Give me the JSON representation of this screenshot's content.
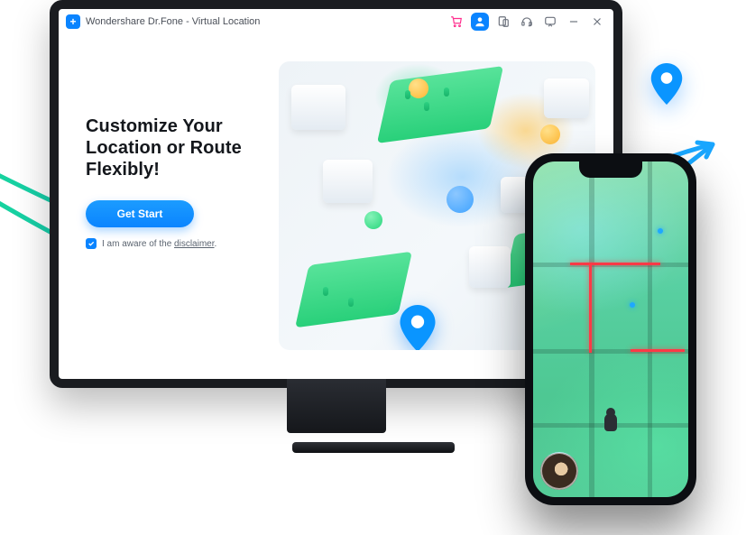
{
  "titlebar": {
    "app_name": "Wondershare Dr.Fone - Virtual Location",
    "icons": {
      "cart": "cart-icon",
      "user": "user-icon",
      "device": "device-icon",
      "support": "headset-icon",
      "feedback": "chat-icon",
      "minimize": "minimize-icon",
      "close": "close-icon"
    }
  },
  "hero": {
    "heading_line1": "Customize Your",
    "heading_line2": "Location or Route",
    "heading_line3": "Flexibly!",
    "cta_label": "Get Start",
    "disclaimer_prefix": "I am aware of the ",
    "disclaimer_link": "disclaimer",
    "disclaimer_suffix": ".",
    "disclaimer_checked": true
  },
  "colors": {
    "accent": "#0a84ff",
    "swoop_a": "#17d39c",
    "swoop_b": "#1aa6ff"
  }
}
